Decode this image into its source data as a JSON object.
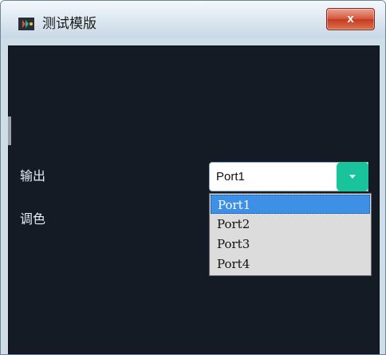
{
  "window": {
    "title": "测试模版",
    "close_glyph": "x",
    "app_icon": "app-logo-icon"
  },
  "form": {
    "output_label": "输出",
    "color_label": "调色"
  },
  "combo": {
    "selected_value": "Port1",
    "arrow_icon": "chevron-down-icon",
    "accent_color": "#19c39c",
    "options": [
      "Port1",
      "Port2",
      "Port3",
      "Port4"
    ],
    "highlighted_option": "Port1"
  },
  "colors": {
    "client_bg": "#141b25",
    "highlight": "#3e8fe6"
  }
}
